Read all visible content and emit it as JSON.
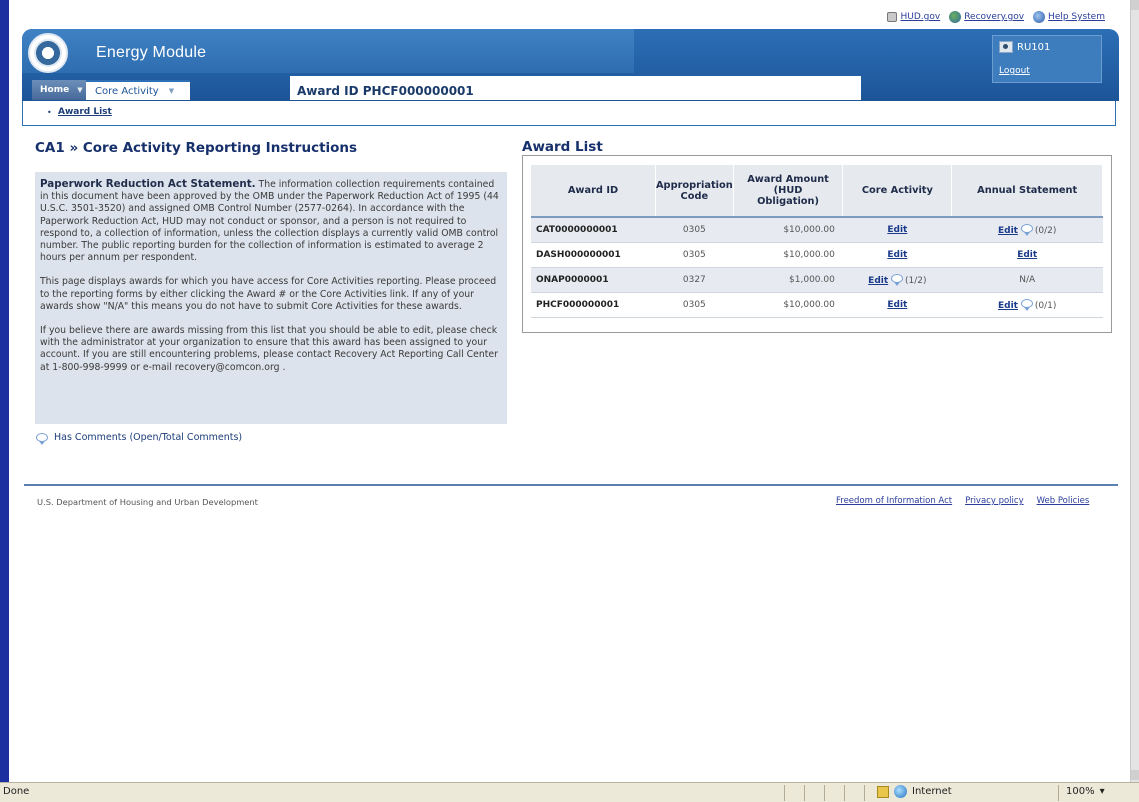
{
  "top_links": [
    {
      "label": "HUD.gov",
      "icon": "hud-flag-icon"
    },
    {
      "label": "Recovery.gov",
      "icon": "recovery-logo-icon"
    },
    {
      "label": "Help System",
      "icon": "help-globe-icon"
    }
  ],
  "header": {
    "app_title": "Energy Module",
    "user": "RU101",
    "logout_label": "Logout"
  },
  "nav": {
    "home_label": "Home",
    "core_label": "Core Activity",
    "award_id_banner": "Award ID PHCF000000001"
  },
  "breadcrumb": {
    "bullet": "•",
    "link": "Award List"
  },
  "left": {
    "title": "CA1 » Core Activity Reporting Instructions",
    "para1_heading": "Paperwork Reduction Act Statement.",
    "para1_body": "The information collection requirements contained in this document have been approved by the OMB under the Paperwork Reduction Act of 1995 (44 U.S.C. 3501-3520) and assigned OMB Control Number (2577-0264). In accordance with the Paperwork Reduction Act, HUD may not conduct or sponsor, and a person is not required to respond to, a collection of information, unless the collection displays a currently valid OMB control number. The public reporting burden for the collection of information is estimated to average 2 hours per annum per respondent.",
    "para2": "This page displays awards for which you have access for Core Activities reporting. Please proceed to the reporting forms by either clicking the Award # or the Core Activities link. If any of your awards show \"N/A\" this means you do not have to submit Core Activities for these awards.",
    "para3": "If you believe there are awards missing from this list that you should be able to edit, please check with the administrator at your organization to ensure that this award has been assigned to your account. If you are still encountering problems, please contact Recovery Act Reporting Call Center at 1-800-998-9999 or e-mail recovery@comcon.org .",
    "legend": "Has Comments (Open/Total Comments)"
  },
  "award_list": {
    "title": "Award List",
    "columns": [
      "Award ID",
      "Appropriation Code",
      "Award Amount (HUD Obligation)",
      "Core Activity",
      "Annual Statement"
    ],
    "rows": [
      {
        "award_id": "CAT0000000001",
        "code": "0305",
        "amount": "$10,000.00",
        "core": "Edit",
        "core_comments": "",
        "annual": "Edit",
        "annual_comments": "(0/2)",
        "annual_is_link": true
      },
      {
        "award_id": "DASH000000001",
        "code": "0305",
        "amount": "$10,000.00",
        "core": "Edit",
        "core_comments": "",
        "annual": "Edit",
        "annual_comments": "",
        "annual_is_link": true
      },
      {
        "award_id": "ONAP0000001",
        "code": "0327",
        "amount": "$1,000.00",
        "core": "Edit",
        "core_comments": "(1/2)",
        "annual": "N/A",
        "annual_comments": "",
        "annual_is_link": false
      },
      {
        "award_id": "PHCF000000001",
        "code": "0305",
        "amount": "$10,000.00",
        "core": "Edit",
        "core_comments": "",
        "annual": "Edit",
        "annual_comments": "(0/1)",
        "annual_is_link": true
      }
    ]
  },
  "footer": {
    "org": "U.S. Department of Housing and Urban Development",
    "links": [
      "Freedom of Information Act",
      "Privacy policy",
      "Web Policies"
    ]
  },
  "statusbar": {
    "status": "Done",
    "zone": "Internet",
    "zoom": "100%",
    "zoom_caret": "▾"
  }
}
